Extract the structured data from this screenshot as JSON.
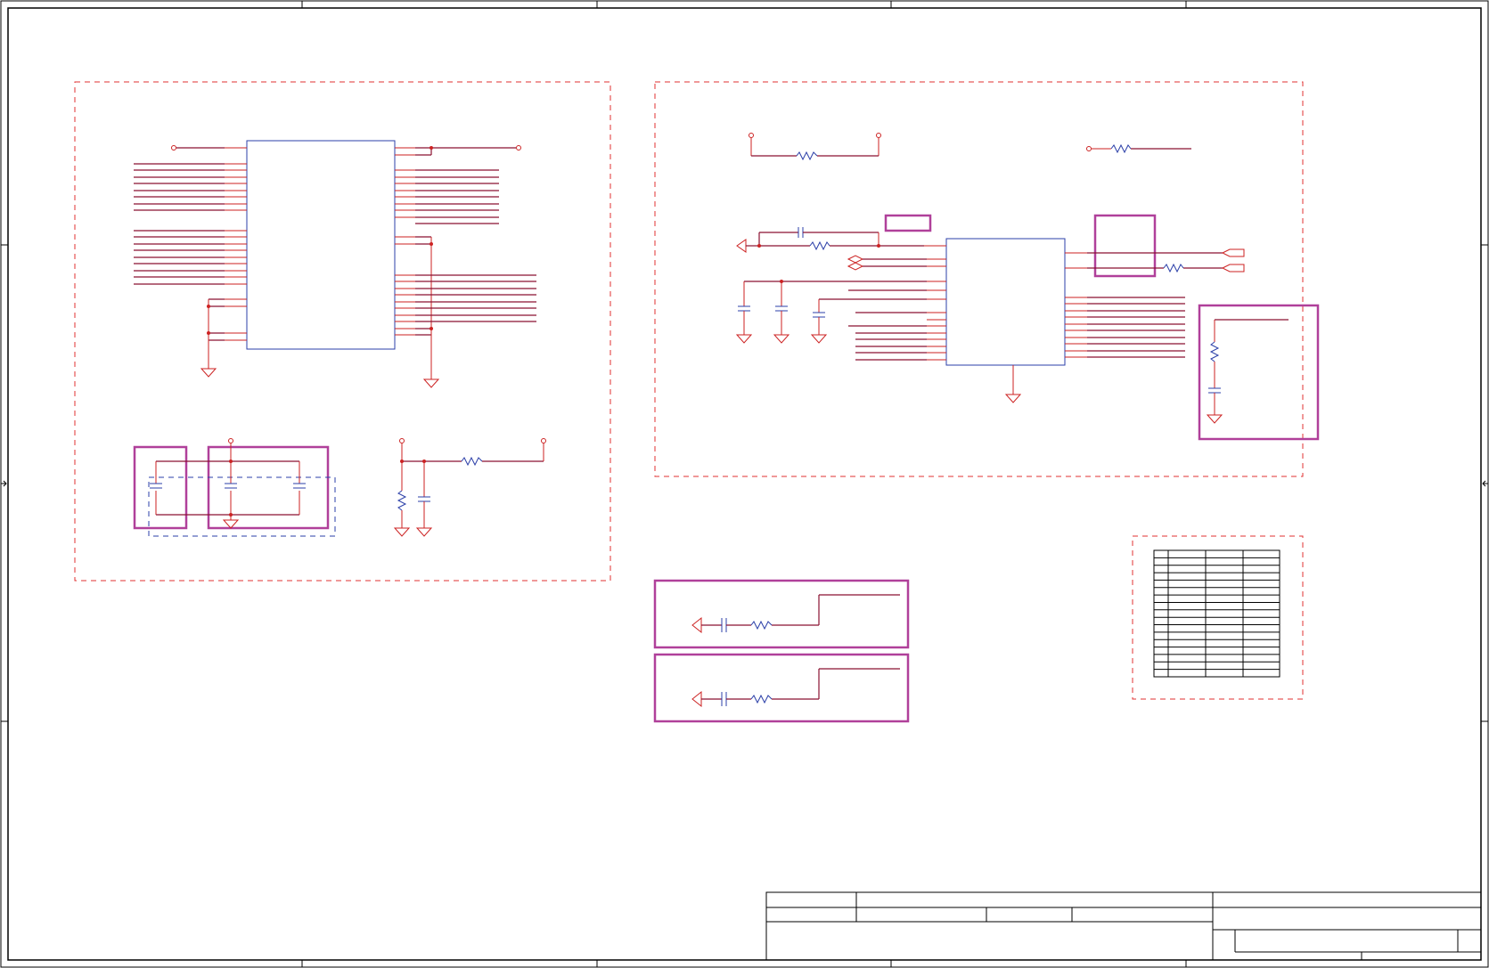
{
  "sheet": {
    "width": 1671,
    "height": 1087,
    "colors": {
      "wire": "#cc2222",
      "bus": "#8a1030",
      "component": "#2b3fa8",
      "highlight": "#b0409a",
      "region_border": "#e03030",
      "frame": "#000000"
    },
    "texts": []
  }
}
